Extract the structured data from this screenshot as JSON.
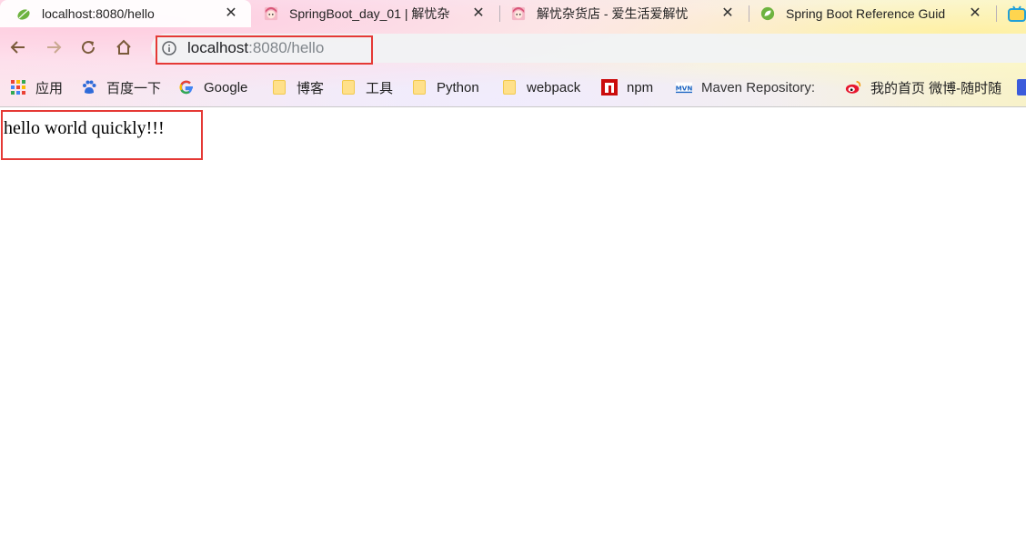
{
  "tabs": [
    {
      "title": "localhost:8080/hello",
      "icon": "spring-leaf-icon",
      "active": true
    },
    {
      "title": "SpringBoot_day_01 | 解忧杂",
      "icon": "anime-avatar-icon",
      "active": false
    },
    {
      "title": "解忧杂货店 - 爱生活爱解忧",
      "icon": "anime-avatar-icon",
      "active": false
    },
    {
      "title": "Spring Boot Reference Guid",
      "icon": "spring-leaf-icon",
      "active": false
    }
  ],
  "tab_close_glyph": "✕",
  "omnibox": {
    "host": "localhost",
    "path": ":8080/hello"
  },
  "bookmarks": [
    {
      "label": "应用",
      "icon": "apps-grid-icon"
    },
    {
      "label": "百度一下",
      "icon": "baidu-paw-icon"
    },
    {
      "label": "Google",
      "icon": "google-g-icon"
    },
    {
      "label": "博客",
      "icon": "folder-icon"
    },
    {
      "label": "工具",
      "icon": "folder-icon"
    },
    {
      "label": "Python",
      "icon": "folder-icon"
    },
    {
      "label": "webpack",
      "icon": "folder-icon"
    },
    {
      "label": "npm",
      "icon": "npm-icon"
    },
    {
      "label": "Maven Repository: ",
      "icon": "maven-icon"
    },
    {
      "label": "我的首页 微博-随时随",
      "icon": "weibo-icon"
    }
  ],
  "content": {
    "text": "hello world quickly!!!"
  },
  "colors": {
    "highlight": "#e53935",
    "spring_green": "#6db33f",
    "url_path": "#80868b"
  }
}
